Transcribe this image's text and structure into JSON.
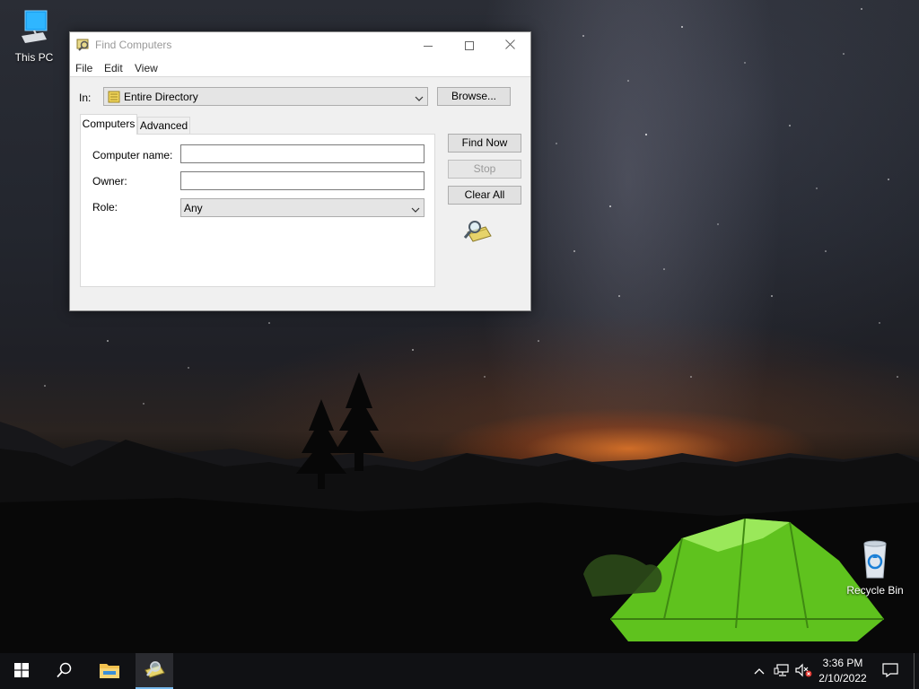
{
  "desktop": {
    "icons": [
      {
        "label": "This PC",
        "icon": "computer-icon"
      },
      {
        "label": "Recycle Bin",
        "icon": "recycle-bin-icon"
      }
    ]
  },
  "window": {
    "title": "Find Computers",
    "menu": [
      "File",
      "Edit",
      "View"
    ],
    "in_label": "In:",
    "scope_value": "Entire Directory",
    "browse_label": "Browse...",
    "tabs": [
      "Computers",
      "Advanced"
    ],
    "fields": {
      "computer_name_label": "Computer name:",
      "computer_name_value": "",
      "owner_label": "Owner:",
      "owner_value": "",
      "role_label": "Role:",
      "role_value": "Any"
    },
    "buttons": {
      "find_now": "Find Now",
      "stop": "Stop",
      "clear_all": "Clear All"
    }
  },
  "taskbar": {
    "time": "3:36 PM",
    "date": "2/10/2022"
  },
  "colors": {
    "taskbar": "#101114",
    "dialog_bg": "#f0f0f0",
    "tent_green": "#7bdc2c"
  }
}
